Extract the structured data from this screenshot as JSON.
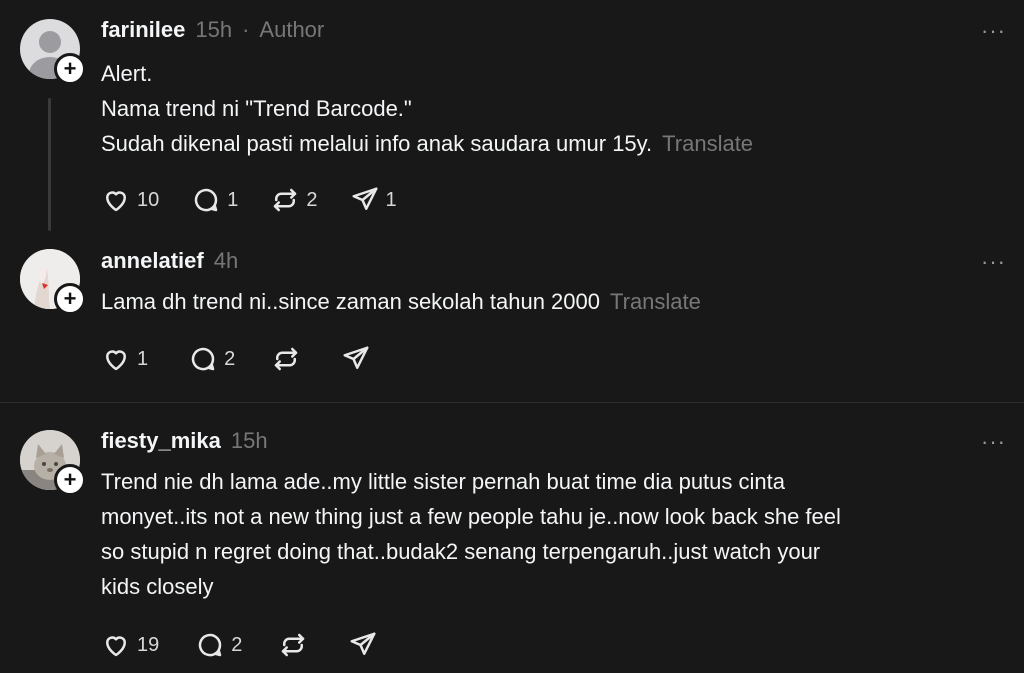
{
  "posts": [
    {
      "username": "farinilee",
      "time": "15h",
      "separator": "·",
      "role": "Author",
      "more": "···",
      "lines": [
        "Alert.",
        "Nama trend ni \"Trend Barcode.\"",
        "Sudah dikenal pasti melalui info anak saudara umur 15y."
      ],
      "translate": "Translate",
      "likes": "10",
      "replies": "1",
      "reposts": "2",
      "shares": "1",
      "avatar_icon": "default-user-icon"
    },
    {
      "username": "annelatief",
      "time": "4h",
      "more": "···",
      "lines": [
        "Lama dh trend ni..since zaman sekolah tahun 2000"
      ],
      "translate": "Translate",
      "likes": "1",
      "replies": "2",
      "avatar_icon": "profile-photo"
    },
    {
      "username": "fiesty_mika",
      "time": "15h",
      "more": "···",
      "lines": [
        "Trend nie dh lama ade..my little sister pernah buat time dia putus cinta",
        "monyet..its not a new thing just a few people tahu je..now look back she feel",
        "so stupid n regret doing that..budak2 senang terpengaruh..just watch your",
        "kids closely"
      ],
      "likes": "19",
      "replies": "2",
      "avatar_icon": "cat-photo"
    }
  ],
  "colors": {
    "background": "#181818",
    "text": "#f3f5f7",
    "muted": "#777777",
    "divider": "#2e2e2e"
  }
}
